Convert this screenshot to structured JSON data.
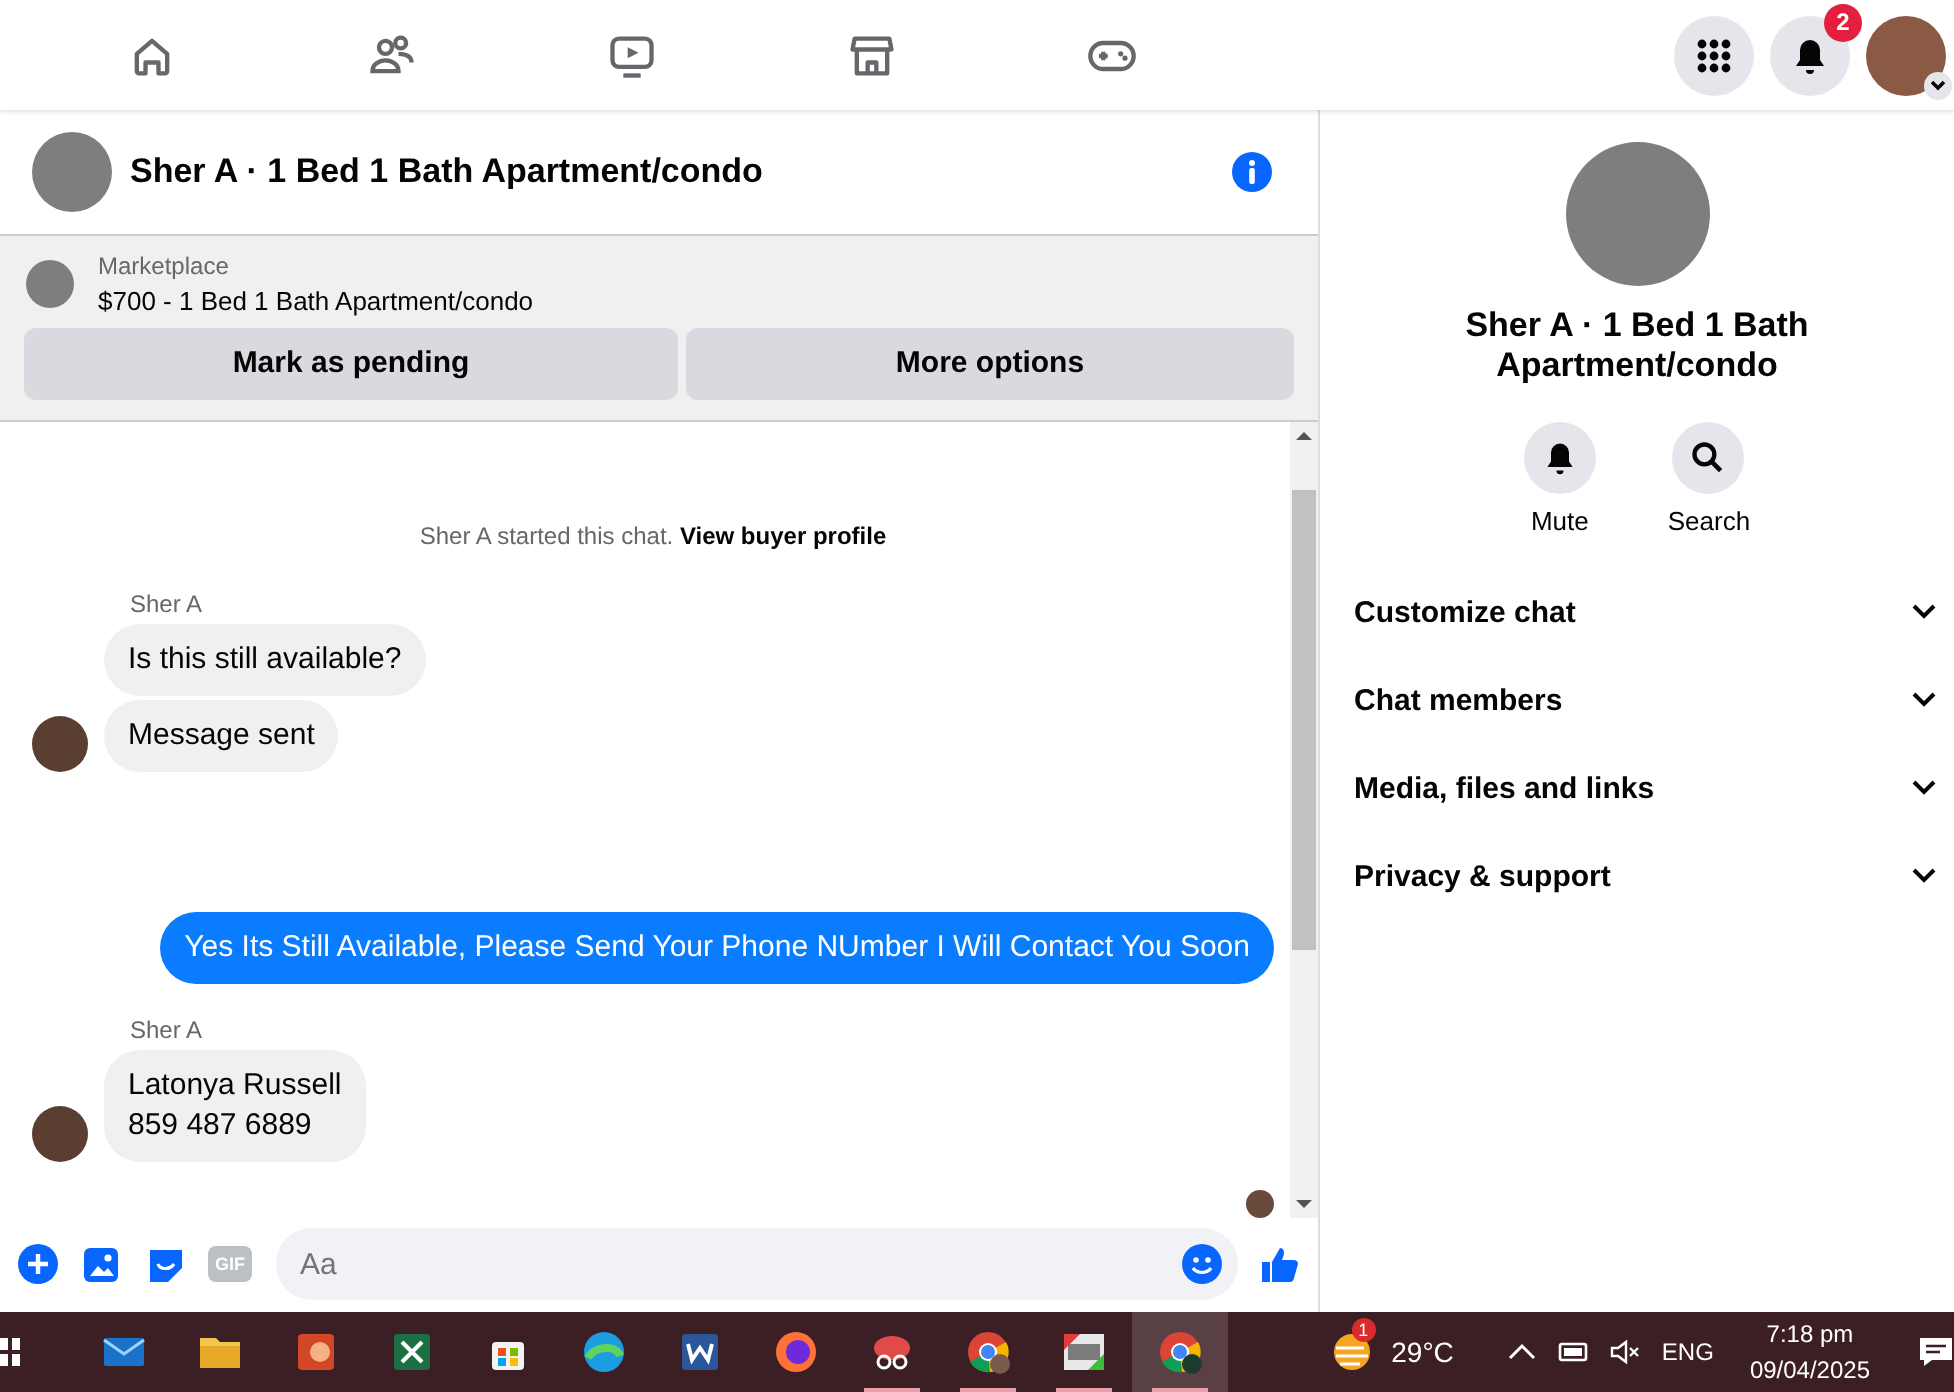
{
  "top_bar": {
    "notifications_badge": "2"
  },
  "chat": {
    "title": "Sher A · 1 Bed 1 Bath Apartment/condo",
    "listing": {
      "label": "Marketplace",
      "title": "$700 - 1 Bed 1 Bath Apartment/condo"
    },
    "buttons": [
      "Mark as pending",
      "More options"
    ],
    "system_message": {
      "text": "Sher A started this chat.",
      "link": "View buyer profile"
    },
    "messages": [
      {
        "kind": "incoming",
        "sender": "Sher A",
        "bubbles": [
          "Is this still available?",
          "Message sent"
        ]
      },
      {
        "kind": "outgoing",
        "bubbles": [
          "Yes Its Still Available, Please Send Your Phone NUmber I Will Contact You Soon"
        ]
      },
      {
        "kind": "incoming",
        "sender": "Sher A",
        "bubbles": [
          "Latonya Russell\n859 487 6889"
        ]
      }
    ],
    "composer": {
      "placeholder": "Aa",
      "gif": "GIF"
    }
  },
  "details": {
    "name": "Sher A · 1 Bed 1 Bath Apartment/condo",
    "actions": [
      {
        "kind": "mute",
        "label": "Mute"
      },
      {
        "kind": "search",
        "label": "Search"
      }
    ],
    "sections": [
      {
        "label": "Customize chat",
        "expanded": false
      },
      {
        "label": "Chat members",
        "expanded": false
      },
      {
        "label": "Media, files and links",
        "expanded": false
      },
      {
        "label": "Privacy & support",
        "expanded": false
      }
    ]
  },
  "taskbar": {
    "apps": [
      {
        "running": false,
        "selected": false
      },
      {
        "running": false,
        "selected": false
      },
      {
        "running": false,
        "selected": false
      },
      {
        "running": false,
        "selected": false
      },
      {
        "running": false,
        "selected": false
      },
      {
        "running": false,
        "selected": false
      },
      {
        "running": false,
        "selected": false
      },
      {
        "running": false,
        "selected": false
      },
      {
        "running": true,
        "selected": false
      },
      {
        "running": true,
        "selected": false
      },
      {
        "running": true,
        "selected": false
      },
      {
        "running": true,
        "selected": true
      }
    ],
    "weather_badge": "1",
    "temperature": "29°C",
    "language": "ENG",
    "time": "7:18 pm",
    "date": "09/04/2025"
  }
}
